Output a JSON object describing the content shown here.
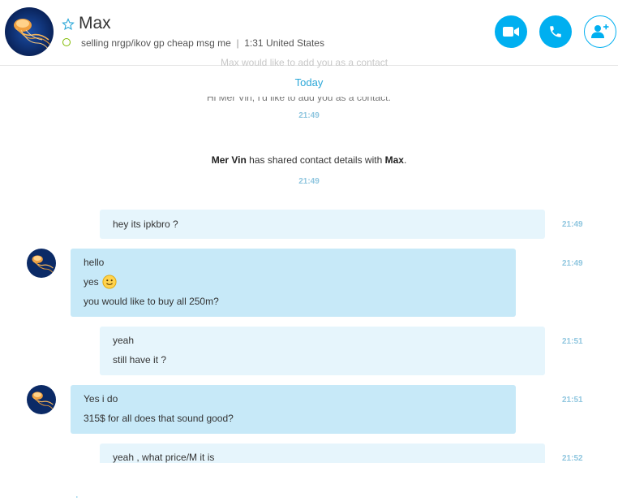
{
  "header": {
    "contact_name": "Max",
    "mood": "selling nrgp/ikov gp cheap msg me",
    "local_time_location": "1:31 United States",
    "icons": {
      "favorite": "star-outline-icon",
      "status": "online-status-icon",
      "video": "video-camera-icon",
      "call": "phone-icon",
      "add_people": "add-person-icon"
    }
  },
  "conversation": {
    "faded_top_text": "Max would like to add you as a contact",
    "date_divider": "Today",
    "request_text": "Hi Mer Vin, I'd like to add you as a contact.",
    "request_time": "21:49",
    "contact_share": {
      "sender": "Mer Vin",
      "middle": " has shared contact details with ",
      "recipient": "Max",
      "end": ".",
      "time": "21:49"
    },
    "messages": [
      {
        "direction": "out",
        "lines": [
          "hey its ipkbro ?"
        ],
        "time": "21:49"
      },
      {
        "direction": "in",
        "lines": [
          "hello",
          "yes",
          "you would like to buy all 250m?"
        ],
        "emoji_on_line": 2,
        "emoji": "smile-emoji",
        "time": "21:49"
      },
      {
        "direction": "out",
        "lines": [
          "yeah",
          "still have it ?"
        ],
        "time": "21:51"
      },
      {
        "direction": "in",
        "lines": [
          "Yes i do",
          "315$ for all does that sound good?"
        ],
        "time": "21:51"
      },
      {
        "direction": "out",
        "lines": [
          "yeah , what price/M it is"
        ],
        "time": "21:52"
      }
    ]
  },
  "colors": {
    "accent": "#00aff0",
    "outgoing_bubble": "#e6f5fc",
    "incoming_bubble": "#c7e9f8",
    "online": "#7fba00",
    "timestamp": "#8fc6df"
  }
}
